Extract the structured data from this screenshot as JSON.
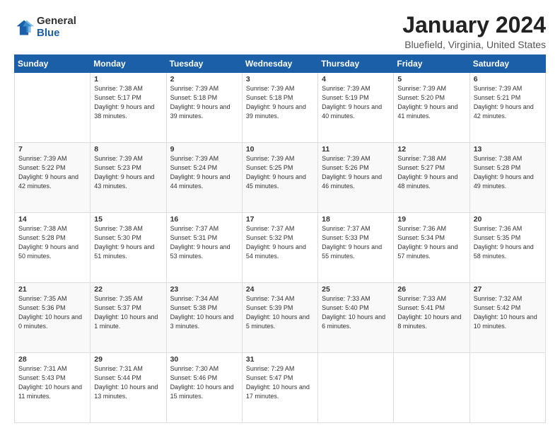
{
  "logo": {
    "general": "General",
    "blue": "Blue"
  },
  "header": {
    "title": "January 2024",
    "subtitle": "Bluefield, Virginia, United States"
  },
  "days_of_week": [
    "Sunday",
    "Monday",
    "Tuesday",
    "Wednesday",
    "Thursday",
    "Friday",
    "Saturday"
  ],
  "weeks": [
    [
      {
        "num": "",
        "sunrise": "",
        "sunset": "",
        "daylight": "",
        "empty": true
      },
      {
        "num": "1",
        "sunrise": "Sunrise: 7:38 AM",
        "sunset": "Sunset: 5:17 PM",
        "daylight": "Daylight: 9 hours and 38 minutes."
      },
      {
        "num": "2",
        "sunrise": "Sunrise: 7:39 AM",
        "sunset": "Sunset: 5:18 PM",
        "daylight": "Daylight: 9 hours and 39 minutes."
      },
      {
        "num": "3",
        "sunrise": "Sunrise: 7:39 AM",
        "sunset": "Sunset: 5:18 PM",
        "daylight": "Daylight: 9 hours and 39 minutes."
      },
      {
        "num": "4",
        "sunrise": "Sunrise: 7:39 AM",
        "sunset": "Sunset: 5:19 PM",
        "daylight": "Daylight: 9 hours and 40 minutes."
      },
      {
        "num": "5",
        "sunrise": "Sunrise: 7:39 AM",
        "sunset": "Sunset: 5:20 PM",
        "daylight": "Daylight: 9 hours and 41 minutes."
      },
      {
        "num": "6",
        "sunrise": "Sunrise: 7:39 AM",
        "sunset": "Sunset: 5:21 PM",
        "daylight": "Daylight: 9 hours and 42 minutes."
      }
    ],
    [
      {
        "num": "7",
        "sunrise": "Sunrise: 7:39 AM",
        "sunset": "Sunset: 5:22 PM",
        "daylight": "Daylight: 9 hours and 42 minutes."
      },
      {
        "num": "8",
        "sunrise": "Sunrise: 7:39 AM",
        "sunset": "Sunset: 5:23 PM",
        "daylight": "Daylight: 9 hours and 43 minutes."
      },
      {
        "num": "9",
        "sunrise": "Sunrise: 7:39 AM",
        "sunset": "Sunset: 5:24 PM",
        "daylight": "Daylight: 9 hours and 44 minutes."
      },
      {
        "num": "10",
        "sunrise": "Sunrise: 7:39 AM",
        "sunset": "Sunset: 5:25 PM",
        "daylight": "Daylight: 9 hours and 45 minutes."
      },
      {
        "num": "11",
        "sunrise": "Sunrise: 7:39 AM",
        "sunset": "Sunset: 5:26 PM",
        "daylight": "Daylight: 9 hours and 46 minutes."
      },
      {
        "num": "12",
        "sunrise": "Sunrise: 7:38 AM",
        "sunset": "Sunset: 5:27 PM",
        "daylight": "Daylight: 9 hours and 48 minutes."
      },
      {
        "num": "13",
        "sunrise": "Sunrise: 7:38 AM",
        "sunset": "Sunset: 5:28 PM",
        "daylight": "Daylight: 9 hours and 49 minutes."
      }
    ],
    [
      {
        "num": "14",
        "sunrise": "Sunrise: 7:38 AM",
        "sunset": "Sunset: 5:28 PM",
        "daylight": "Daylight: 9 hours and 50 minutes."
      },
      {
        "num": "15",
        "sunrise": "Sunrise: 7:38 AM",
        "sunset": "Sunset: 5:30 PM",
        "daylight": "Daylight: 9 hours and 51 minutes."
      },
      {
        "num": "16",
        "sunrise": "Sunrise: 7:37 AM",
        "sunset": "Sunset: 5:31 PM",
        "daylight": "Daylight: 9 hours and 53 minutes."
      },
      {
        "num": "17",
        "sunrise": "Sunrise: 7:37 AM",
        "sunset": "Sunset: 5:32 PM",
        "daylight": "Daylight: 9 hours and 54 minutes."
      },
      {
        "num": "18",
        "sunrise": "Sunrise: 7:37 AM",
        "sunset": "Sunset: 5:33 PM",
        "daylight": "Daylight: 9 hours and 55 minutes."
      },
      {
        "num": "19",
        "sunrise": "Sunrise: 7:36 AM",
        "sunset": "Sunset: 5:34 PM",
        "daylight": "Daylight: 9 hours and 57 minutes."
      },
      {
        "num": "20",
        "sunrise": "Sunrise: 7:36 AM",
        "sunset": "Sunset: 5:35 PM",
        "daylight": "Daylight: 9 hours and 58 minutes."
      }
    ],
    [
      {
        "num": "21",
        "sunrise": "Sunrise: 7:35 AM",
        "sunset": "Sunset: 5:36 PM",
        "daylight": "Daylight: 10 hours and 0 minutes."
      },
      {
        "num": "22",
        "sunrise": "Sunrise: 7:35 AM",
        "sunset": "Sunset: 5:37 PM",
        "daylight": "Daylight: 10 hours and 1 minute."
      },
      {
        "num": "23",
        "sunrise": "Sunrise: 7:34 AM",
        "sunset": "Sunset: 5:38 PM",
        "daylight": "Daylight: 10 hours and 3 minutes."
      },
      {
        "num": "24",
        "sunrise": "Sunrise: 7:34 AM",
        "sunset": "Sunset: 5:39 PM",
        "daylight": "Daylight: 10 hours and 5 minutes."
      },
      {
        "num": "25",
        "sunrise": "Sunrise: 7:33 AM",
        "sunset": "Sunset: 5:40 PM",
        "daylight": "Daylight: 10 hours and 6 minutes."
      },
      {
        "num": "26",
        "sunrise": "Sunrise: 7:33 AM",
        "sunset": "Sunset: 5:41 PM",
        "daylight": "Daylight: 10 hours and 8 minutes."
      },
      {
        "num": "27",
        "sunrise": "Sunrise: 7:32 AM",
        "sunset": "Sunset: 5:42 PM",
        "daylight": "Daylight: 10 hours and 10 minutes."
      }
    ],
    [
      {
        "num": "28",
        "sunrise": "Sunrise: 7:31 AM",
        "sunset": "Sunset: 5:43 PM",
        "daylight": "Daylight: 10 hours and 11 minutes."
      },
      {
        "num": "29",
        "sunrise": "Sunrise: 7:31 AM",
        "sunset": "Sunset: 5:44 PM",
        "daylight": "Daylight: 10 hours and 13 minutes."
      },
      {
        "num": "30",
        "sunrise": "Sunrise: 7:30 AM",
        "sunset": "Sunset: 5:46 PM",
        "daylight": "Daylight: 10 hours and 15 minutes."
      },
      {
        "num": "31",
        "sunrise": "Sunrise: 7:29 AM",
        "sunset": "Sunset: 5:47 PM",
        "daylight": "Daylight: 10 hours and 17 minutes."
      },
      {
        "num": "",
        "sunrise": "",
        "sunset": "",
        "daylight": "",
        "empty": true
      },
      {
        "num": "",
        "sunrise": "",
        "sunset": "",
        "daylight": "",
        "empty": true
      },
      {
        "num": "",
        "sunrise": "",
        "sunset": "",
        "daylight": "",
        "empty": true
      }
    ]
  ]
}
